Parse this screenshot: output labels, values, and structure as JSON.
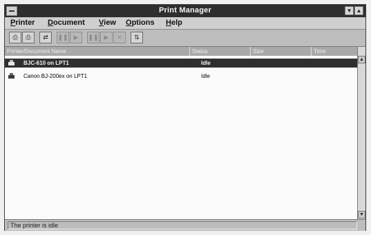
{
  "window": {
    "title": "Print Manager",
    "minimize_glyph": "▼",
    "maximize_glyph": "▲"
  },
  "menu": [
    {
      "first": "P",
      "rest": "rinter"
    },
    {
      "first": "D",
      "rest": "ocument"
    },
    {
      "first": "V",
      "rest": "iew"
    },
    {
      "first": "O",
      "rest": "ptions"
    },
    {
      "first": "H",
      "rest": "elp"
    }
  ],
  "toolbar": [
    {
      "icon": "printer-properties-icon",
      "glyph": "⎙"
    },
    {
      "icon": "connect-printer-icon",
      "glyph": "⎙"
    },
    {
      "icon": "share-printer-icon",
      "glyph": "⇄"
    },
    {
      "icon": "pause-printer-icon",
      "glyph": "❚❚"
    },
    {
      "icon": "resume-printer-icon",
      "glyph": "▶"
    },
    {
      "icon": "pause-document-icon",
      "glyph": "❚❚"
    },
    {
      "icon": "resume-document-icon",
      "glyph": "▶"
    },
    {
      "icon": "delete-document-icon",
      "glyph": "✕"
    },
    {
      "icon": "move-document-icon",
      "glyph": "⇅"
    }
  ],
  "columns": [
    "Printer/Document Name",
    "Status",
    "Size",
    "Time"
  ],
  "rows": [
    {
      "name": "BJC-610 on LPT1",
      "status": "Idle",
      "selected": true
    },
    {
      "name": "Canon BJ-200ex on LPT1",
      "status": "Idle",
      "selected": false
    }
  ],
  "scrollbar": {
    "up_glyph": "▲",
    "down_glyph": "▼"
  },
  "status_text": "The printer is idle"
}
